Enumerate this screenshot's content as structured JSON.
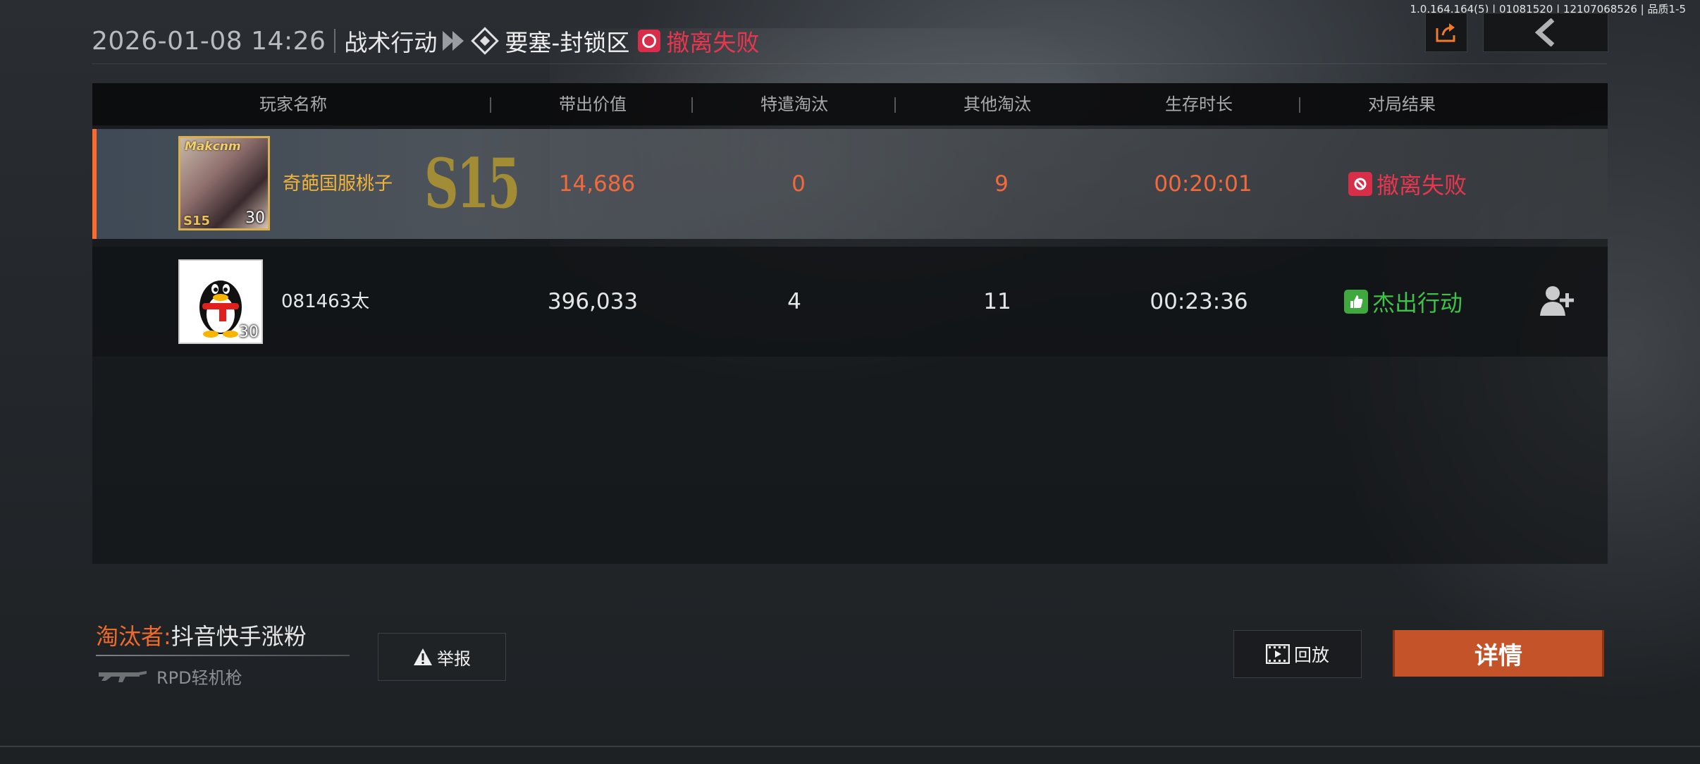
{
  "version_text": "1.0.164.164(5) | 01081520 | 12107068526 | 品质1-5",
  "header": {
    "datetime": "2026-01-08 14:26",
    "mode": "战术行动",
    "map": "要塞-封锁区",
    "result": "撤离失败",
    "result_color": "#e8364f"
  },
  "table": {
    "columns": [
      "玩家名称",
      "带出价值",
      "特遣淘汰",
      "其他淘汰",
      "生存时长",
      "对局结果"
    ],
    "rows": [
      {
        "name": "奇葩国服桃子",
        "level": "30",
        "season_badge": "S15",
        "avatar_frame_text": "Makcnm",
        "value": "14,686",
        "task_kills": "0",
        "other_kills": "9",
        "survival": "00:20:01",
        "result": "撤离失败",
        "result_color": "#e8364f",
        "text_color": "#f26a3c",
        "name_color": "#f0b43a",
        "highlighted": true
      },
      {
        "name": "081463太",
        "level": "30",
        "value": "396,033",
        "task_kills": "4",
        "other_kills": "11",
        "survival": "00:23:36",
        "result": "杰出行动",
        "result_color": "#3fc24a",
        "text_color": "#e4e6e8",
        "name_color": "#e4e6e8",
        "highlighted": false
      }
    ]
  },
  "eliminator": {
    "label": "淘汰者:",
    "name": "抖音快手涨粉",
    "weapon": "RPD轻机枪"
  },
  "buttons": {
    "report": "举报",
    "replay": "回放",
    "detail": "详情"
  },
  "colors": {
    "accent_orange": "#f06a2b",
    "detail_button": "#c4532a",
    "fail_red": "#e8364f",
    "success_green": "#3fc24a"
  }
}
